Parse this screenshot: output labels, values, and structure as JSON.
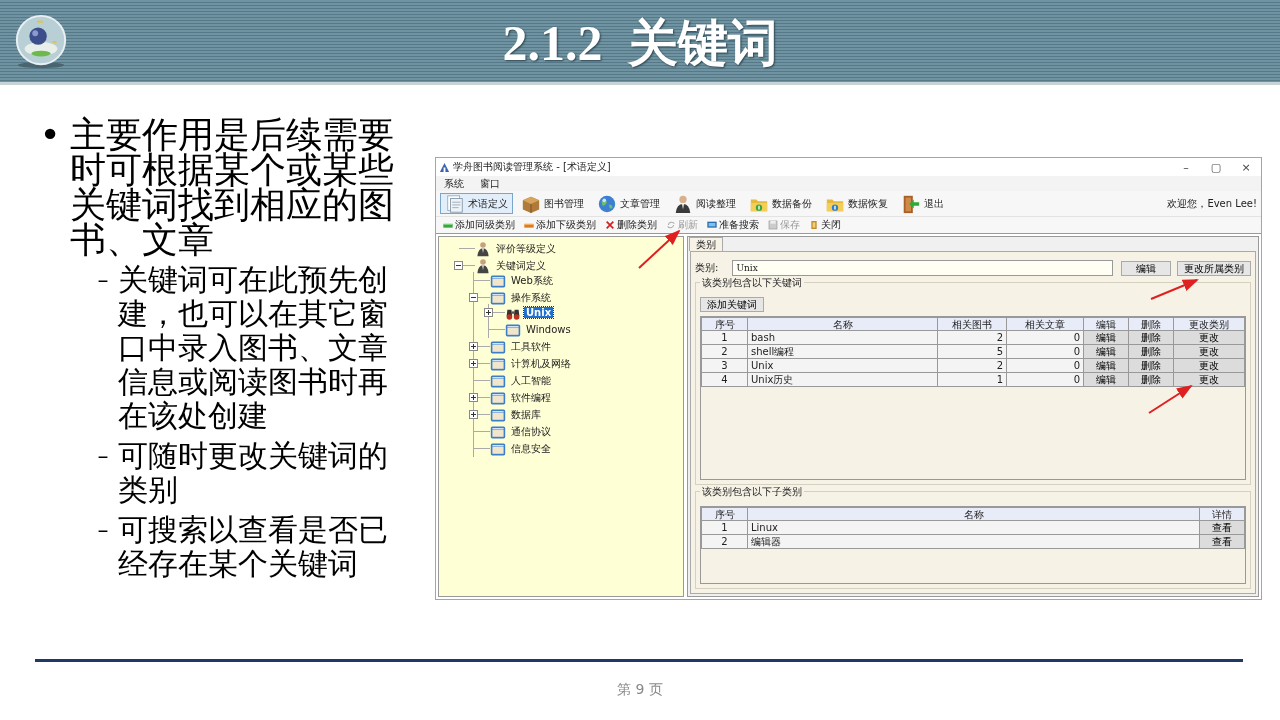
{
  "slide": {
    "title": "2.1.2  关键词",
    "page": "第 9 页"
  },
  "bullets": [
    {
      "marker": "•",
      "text": "主要作用是后续需要时可根据某个或某些关键词找到相应的图书、文章",
      "children": [
        {
          "marker": "–",
          "text": "关键词可在此预先创建，也可以在其它窗口中录入图书、文章信息或阅读图书时再在该处创建"
        },
        {
          "marker": "–",
          "text": "可随时更改关键词的类别"
        },
        {
          "marker": "–",
          "text": "可搜索以查看是否已经存在某个关键词"
        }
      ]
    }
  ],
  "app": {
    "window": {
      "title": "学舟图书阅读管理系统 - [术语定义]",
      "controls": [
        "–",
        "▢",
        "×"
      ]
    },
    "menu": [
      "系统",
      "窗口"
    ],
    "toolbar": [
      {
        "kind": "terms",
        "label": "术语定义",
        "selected": true
      },
      {
        "kind": "books",
        "label": "图书管理",
        "selected": false
      },
      {
        "kind": "globe",
        "label": "文章管理",
        "selected": false
      },
      {
        "kind": "person",
        "label": "阅读整理",
        "selected": false
      },
      {
        "kind": "folder-green",
        "label": "数据备份",
        "selected": false
      },
      {
        "kind": "folder-blue",
        "label": "数据恢复",
        "selected": false
      },
      {
        "kind": "exit",
        "label": "退出",
        "selected": false
      }
    ],
    "welcome": "欢迎您，Even Lee!",
    "actions": [
      {
        "kind": "add-green",
        "label": "添加同级类别",
        "disabled": false
      },
      {
        "kind": "add-orange",
        "label": "添加下级类别",
        "disabled": false
      },
      {
        "kind": "delete",
        "label": "删除类别",
        "disabled": false
      },
      {
        "kind": "refresh",
        "label": "刷新",
        "disabled": true
      },
      {
        "kind": "search",
        "label": "准备搜索",
        "disabled": false
      },
      {
        "kind": "save",
        "label": "保存",
        "disabled": true
      },
      {
        "kind": "close",
        "label": "关闭",
        "disabled": false
      }
    ],
    "tree": [
      {
        "kind": "person",
        "label": "评价等级定义",
        "selected": false
      },
      {
        "kind": "person",
        "label": "关键词定义",
        "selected": false,
        "expanded": true,
        "children": [
          {
            "kind": "folder",
            "label": "Web系统",
            "selected": false
          },
          {
            "kind": "folder",
            "label": "操作系统",
            "selected": false,
            "expanded": true,
            "children": [
              {
                "kind": "binoculars",
                "label": "Unix",
                "selected": true,
                "expanded": false
              },
              {
                "kind": "folder",
                "label": "Windows",
                "selected": false
              }
            ]
          },
          {
            "kind": "folder",
            "label": "工具软件",
            "selected": false,
            "expanded": false
          },
          {
            "kind": "folder",
            "label": "计算机及网络",
            "selected": false,
            "expanded": false
          },
          {
            "kind": "folder",
            "label": "人工智能",
            "selected": false
          },
          {
            "kind": "folder",
            "label": "软件编程",
            "selected": false,
            "expanded": false
          },
          {
            "kind": "folder",
            "label": "数据库",
            "selected": false,
            "expanded": false
          },
          {
            "kind": "folder",
            "label": "通信协议",
            "selected": false
          },
          {
            "kind": "folder",
            "label": "信息安全",
            "selected": false
          }
        ]
      }
    ],
    "tab": {
      "label": "类别",
      "selected": true
    },
    "category": {
      "label": "类别:",
      "value": "Unix",
      "buttons": [
        "编辑",
        "更改所属类别"
      ]
    },
    "keywords": {
      "title": "该类别包含以下关键词",
      "add_button": "添加关键词",
      "columns": [
        "序号",
        "名称",
        "相关图书",
        "相关文章",
        "编辑",
        "删除",
        "更改类别"
      ],
      "rows": [
        [
          "1",
          "bash",
          "2",
          "0",
          "编辑",
          "删除",
          "更改"
        ],
        [
          "2",
          "shell编程",
          "5",
          "0",
          "编辑",
          "删除",
          "更改"
        ],
        [
          "3",
          "Unix",
          "2",
          "0",
          "编辑",
          "删除",
          "更改"
        ],
        [
          "4",
          "Unix历史",
          "1",
          "0",
          "编辑",
          "删除",
          "更改"
        ]
      ]
    },
    "subcategories": {
      "title": "该类别包含以下子类别",
      "columns": [
        "序号",
        "名称",
        "详情"
      ],
      "rows": [
        [
          "1",
          "Linux",
          "查看"
        ],
        [
          "2",
          "编辑器",
          "查看"
        ]
      ]
    }
  }
}
